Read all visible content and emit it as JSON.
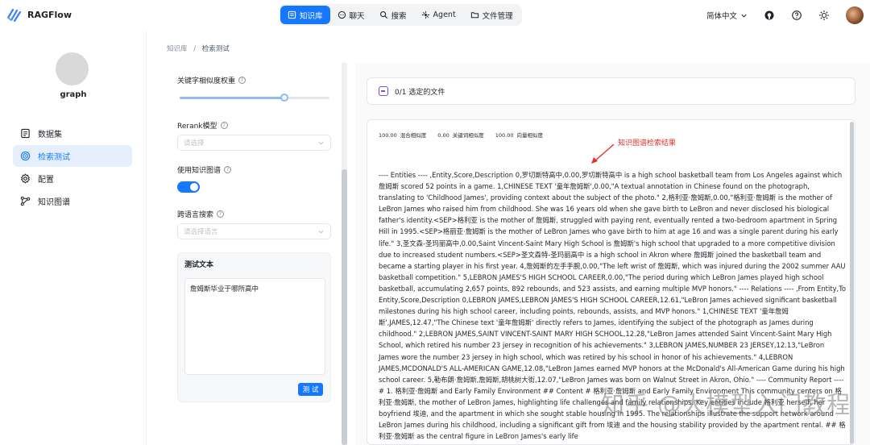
{
  "app": {
    "name": "RAGFlow"
  },
  "nav": {
    "items": [
      {
        "label": "知识库",
        "icon": "database-icon",
        "active": true
      },
      {
        "label": "聊天",
        "icon": "chat-icon",
        "active": false
      },
      {
        "label": "搜索",
        "icon": "search-icon",
        "active": false
      },
      {
        "label": "Agent",
        "icon": "agent-icon",
        "active": false
      },
      {
        "label": "文件管理",
        "icon": "folder-icon",
        "active": false
      }
    ]
  },
  "topright": {
    "language": "简体中文"
  },
  "sidebar": {
    "kb_name": "graph",
    "items": [
      {
        "label": "数据集",
        "icon": "dataset-icon"
      },
      {
        "label": "检索测试",
        "icon": "retrieval-icon"
      },
      {
        "label": "配置",
        "icon": "gear-icon"
      },
      {
        "label": "知识图谱",
        "icon": "graph-icon"
      }
    ]
  },
  "breadcrumb": {
    "root": "知识库",
    "separator": "/",
    "current": "检索测试"
  },
  "form": {
    "keyword_weight_label": "关键字相似度权重",
    "keyword_weight_value": 0.7,
    "rerank_label": "Rerank模型",
    "rerank_placeholder": "请选择",
    "kg_label": "使用知识图谱",
    "kg_enabled": true,
    "cross_lang_label": "跨语言搜索",
    "cross_lang_placeholder": "请选择语言",
    "test_title": "测试文本",
    "test_value": "詹姆斯毕业于哪所高中",
    "test_button": "测 试"
  },
  "results": {
    "selected_files": "0/1 选定的文件",
    "hybrid_score": "100.00",
    "hybrid_label": "混合相似度",
    "keyword_score": "0.00",
    "keyword_label": "关键词相似度",
    "vector_score": "100.00",
    "vector_label": "向量相似度",
    "annotation": "知识图谱检索结果",
    "text": "---- Entities ---- ,Entity,Score,Description 0,罗切斯特高中,0.00,罗切斯特高中 is a high school basketball team from Los Angeles against which 詹姆斯 scored 52 points in a game. 1,CHINESE TEXT '童年詹姆斯',0.00,\"A textual annotation in Chinese found on the photograph, translating to 'Childhood James', providing context about the subject of the photo.\" 2,格利亚·詹姆斯,0.00,\"格利亚·詹姆斯 is the mother of LeBron James who raised him from childhood. She was 16 years old when she gave birth to LeBron and never disclosed his biological father's identity.<SEP>格利亚 is the mother of 詹姆斯, struggled with paying rent, eventually rented a two-bedroom apartment in Spring Hill in 1995.<SEP>格丽亚·詹姆斯 is the mother of LeBron James who gave birth to him at age 16 and was a single parent during his early life.\" 3,圣文森-圣玛丽高中,0.00,Saint Vincent-Saint Mary High School is 詹姆斯's high school that upgraded to a more competitive division due to increased student numbers.<SEP>圣文森特-圣玛丽高中 is a high school in Akron where 詹姆斯 joined the basketball team and became a starting player in his first year. 4,詹姆斯的左手手腕,0.00,\"The left wrist of 詹姆斯, which was injured during the 2002 summer AAU basketball competition.\" 5,LEBRON JAMES'S HIGH SCHOOL CAREER,0.00,\"The period during which LeBron James played high school basketball, accumulating 2,657 points, 892 rebounds, and 523 assists, and earning multiple MVP honors.\" ---- Relations ---- ,From Entity,To Entity,Score,Description 0,LEBRON JAMES,LEBRON JAMES'S HIGH SCHOOL CAREER,12.61,\"LeBron James achieved significant basketball milestones during his high school career, including points, rebounds, assists, and MVP honors.\" 1,CHINESE TEXT '童年詹姆斯',JAMES,12.47,\"The Chinese text '童年詹姆斯' directly refers to James, identifying the subject of the photograph as James during childhood.\" 2,LEBRON JAMES,SAINT VINCENT-SAINT MARY HIGH SCHOOL,12.28,\"LeBron James attended Saint Vincent-Saint Mary High School, which retired his number 23 jersey in recognition of his achievements.\" 3,LEBRON JAMES,NUMBER 23 JERSEY,12.13,\"LeBron James wore the number 23 jersey in high school, which was retired by his school in honor of his achievements.\" 4,LEBRON JAMES,MCDONALD'S ALL-AMERICAN GAME,12.08,\"LeBron James earned MVP honors at the McDonald's All-American Game during his high school career. 5,勒布朗·詹姆斯,詹姆斯,胡桃树大街,12.07,\"LeBron James was born on Walnut Street in Akron, Ohio.\" ---- Community Report ---- # 1. 格利亚·詹姆斯 and Early Family Environment ## Content # 格利亚·詹姆斯 and Early Family Environment This community centers on 格利亚·詹姆斯, the mother of LeBron James, highlighting life challenges and family relationships. Key entities include 格利亚 herself, her boyfriend 埃迪, and the apartment in which she sought stable housing in 1995. The relationships illustrate the support network around LeBron James during his childhood, including a significant gift from 埃迪 and the housing stability provided by the apartment rental. ## 格利亚·詹姆斯 as the central figure in LeBron James's early life",
    "watermark": "知乎 @大模型入门教程"
  }
}
